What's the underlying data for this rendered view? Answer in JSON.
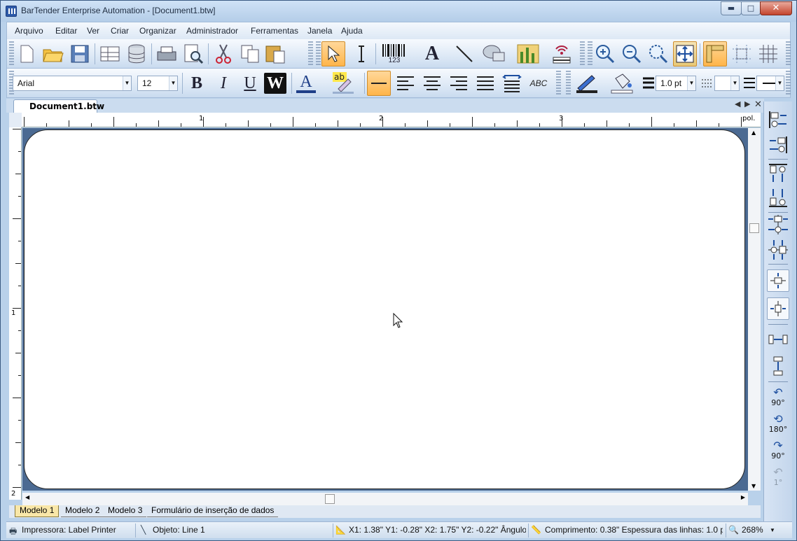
{
  "window": {
    "title": "BarTender Enterprise Automation - [Document1.btw]",
    "minimize": "▬",
    "maximize": "□",
    "close": "✕"
  },
  "menu": [
    "Arquivo",
    "Editar",
    "Ver",
    "Criar",
    "Organizar",
    "Administrador",
    "Ferramentas",
    "Janela",
    "Ajuda"
  ],
  "format": {
    "font": "Arial",
    "size": "12",
    "bold": "B",
    "italic": "I",
    "underline": "U",
    "reverse": "W",
    "font_color": "A",
    "highlight": "ab",
    "text_tool": "A",
    "spell": "ABC",
    "line_weight": "1.0 pt",
    "barcode_digits": "123"
  },
  "document": {
    "tab": "Document1.btw",
    "units": "pol.",
    "ruler_h": [
      "1",
      "2",
      "3"
    ],
    "ruler_v": [
      "1",
      "2"
    ]
  },
  "sheets": [
    "Modelo 1",
    "Modelo 2",
    "Modelo 3",
    "Formulário de inserção de dados"
  ],
  "rotate": [
    "90°",
    "180°",
    "90°",
    "1°"
  ],
  "status": {
    "printer": "Impressora: Label Printer",
    "object": "Objeto: Line 1",
    "coords": "X1: 1.38\"  Y1: -0.28\"  X2: 1.75\"  Y2: -0.22\"  Ângulo",
    "length": "Comprimento: 0.38\"  Espessura das linhas: 1.0 pt",
    "zoom": "268%"
  },
  "colors": {
    "accent": "#ffb54a",
    "frame": "#b9d1ea",
    "canvas": "#4b6a92"
  }
}
